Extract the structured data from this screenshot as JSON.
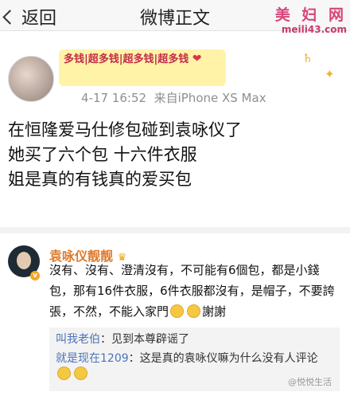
{
  "nav": {
    "back_label": "返回",
    "title": "微博正文",
    "watermark_cn": "美 妇 网",
    "watermark_url": "meili43.com"
  },
  "post": {
    "nickname": "多钱|超多钱|超多钱|超多钱",
    "heart": "❤",
    "time": "4-17 16:52",
    "source": "来自iPhone XS Max",
    "lines": [
      "在恒隆爱马仕修包碰到袁咏仪了",
      "她买了六个包 十六件衣服",
      "姐是真的有钱真的爱买包"
    ]
  },
  "comment": {
    "name": "袁咏仪靓靓",
    "crown": "♛",
    "badge": "v",
    "text_part1": "沒有、沒有、澄清沒有，不可能有6個包，都是小錢包，那有16件衣服，6件衣服都沒有，是帽子，不要誇張，不然，不能入家門",
    "text_part2": "謝謝"
  },
  "replies": [
    {
      "name": "叫我老伯",
      "text": "：见到本尊辟谣了"
    },
    {
      "name": "就是现在1209",
      "text": "：这是真的袁咏仪嘛为什么没有人评论"
    }
  ],
  "corner_text": "@悦悦生活"
}
